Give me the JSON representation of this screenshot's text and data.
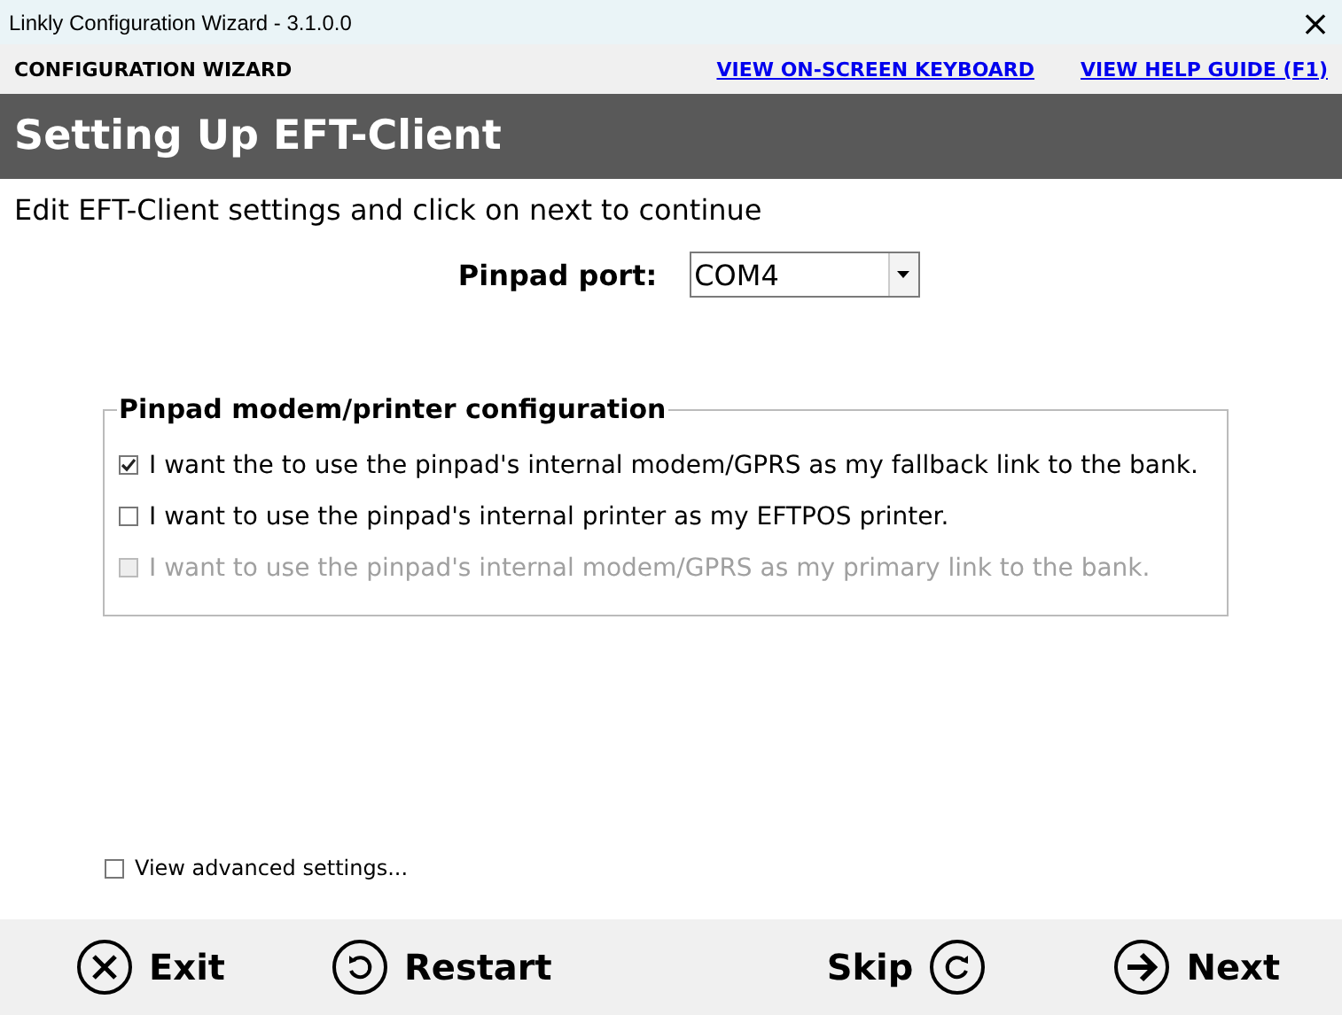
{
  "window": {
    "title": "Linkly Configuration Wizard - 3.1.0.0",
    "close": "×"
  },
  "toolbar": {
    "title": "CONFIGURATION WIZARD",
    "links": [
      "VIEW ON-SCREEN KEYBOARD",
      "VIEW HELP GUIDE (F1)"
    ]
  },
  "header": "Setting Up EFT-Client",
  "instruction": "Edit EFT-Client settings and click on next to continue",
  "pinpad_port": {
    "label": "Pinpad port:",
    "value": "COM4"
  },
  "group": {
    "title": "Pinpad modem/printer configuration",
    "options": [
      {
        "label": "I want the to use the pinpad's internal modem/GPRS as my fallback link to the bank.",
        "checked": true,
        "disabled": false
      },
      {
        "label": "I want to use the pinpad's internal printer as my EFTPOS printer.",
        "checked": false,
        "disabled": false
      },
      {
        "label": "I want to use the pinpad's internal modem/GPRS as my primary link to the bank.",
        "checked": false,
        "disabled": true
      }
    ]
  },
  "advanced": {
    "label": "View advanced settings...",
    "checked": false
  },
  "buttons": [
    {
      "label": "Exit",
      "kind": "exit"
    },
    {
      "label": "Restart",
      "kind": "restart"
    },
    {
      "label": "Skip",
      "kind": "skip"
    },
    {
      "label": "Next",
      "kind": "next"
    }
  ]
}
